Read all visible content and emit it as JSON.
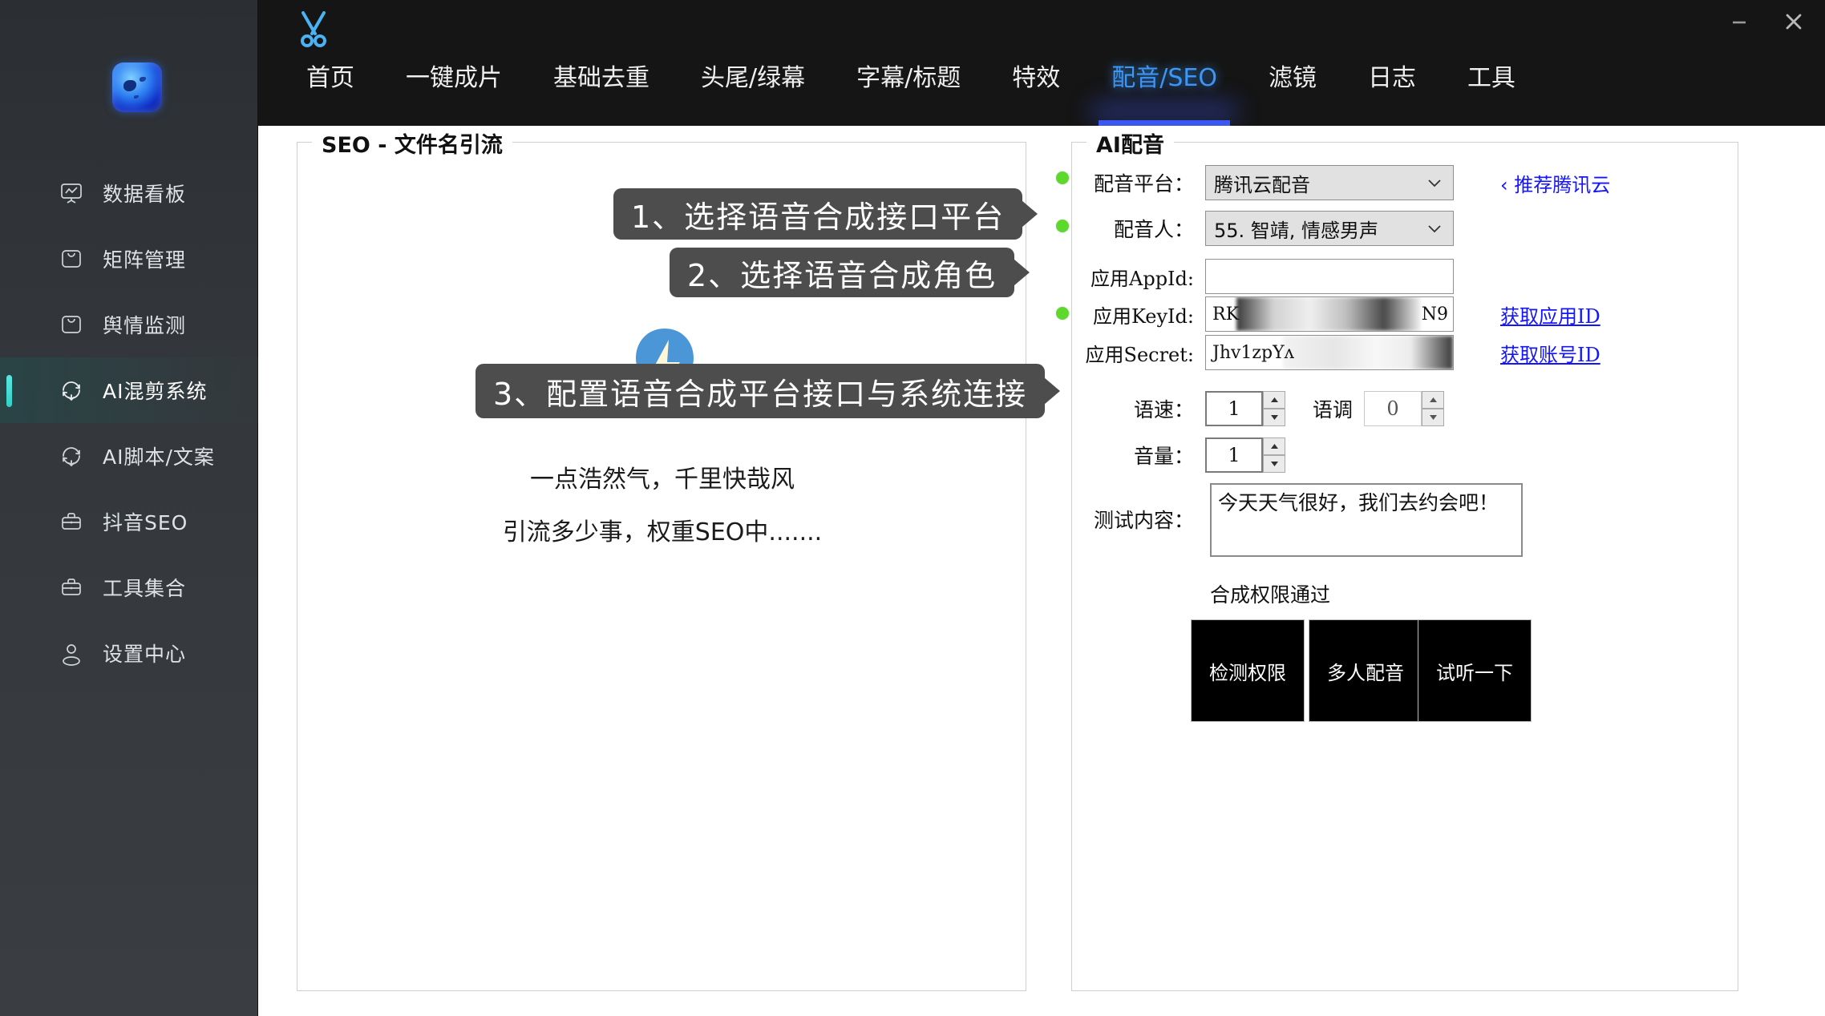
{
  "window": {
    "minimize_label": "–",
    "close_label": "✕"
  },
  "sidebar": {
    "logo_name": "app-logo",
    "items": [
      {
        "label": "数据看板",
        "icon": "dashboard-icon",
        "active": false
      },
      {
        "label": "矩阵管理",
        "icon": "matrix-icon",
        "active": false
      },
      {
        "label": "舆情监测",
        "icon": "monitor-icon",
        "active": false
      },
      {
        "label": "AI混剪系统",
        "icon": "refresh-icon",
        "active": true
      },
      {
        "label": "AI脚本/文案",
        "icon": "refresh-icon",
        "active": false
      },
      {
        "label": "抖音SEO",
        "icon": "briefcase-icon",
        "active": false
      },
      {
        "label": "工具集合",
        "icon": "briefcase-icon",
        "active": false
      },
      {
        "label": "设置中心",
        "icon": "user-icon",
        "active": false
      }
    ]
  },
  "topbar": {
    "logo_icon": "scissors-icon",
    "tabs": [
      {
        "label": "首页",
        "active": false
      },
      {
        "label": "一键成片",
        "active": false
      },
      {
        "label": "基础去重",
        "active": false
      },
      {
        "label": "头尾/绿幕",
        "active": false
      },
      {
        "label": "字幕/标题",
        "active": false
      },
      {
        "label": "特效",
        "active": false
      },
      {
        "label": "配音/SEO",
        "active": true
      },
      {
        "label": "滤镜",
        "active": false
      },
      {
        "label": "日志",
        "active": false
      },
      {
        "label": "工具",
        "active": false
      }
    ]
  },
  "seo_panel": {
    "title": "SEO - 文件名引流",
    "bulb_icon": "lightbulb-icon",
    "line1": "一点浩然气，千里快哉风",
    "line2": "引流多少事，权重SEO中......."
  },
  "ai_panel": {
    "title": "AI配音",
    "platform": {
      "label": "配音平台：",
      "value": "腾讯云配音",
      "hint": "‹ 推荐腾讯云"
    },
    "speaker": {
      "label": "配音人：",
      "value": "55. 智靖, 情感男声"
    },
    "appid": {
      "label": "应用AppId:",
      "value": "",
      "placeholder": ""
    },
    "keyid": {
      "label": "应用KeyId:",
      "value_prefix": "RK",
      "value_suffix": "N9",
      "link": "获取应用ID"
    },
    "secret": {
      "label": "应用Secret:",
      "value_prefix": "Jhv1zpYʌ",
      "link": "获取账号ID"
    },
    "speed": {
      "label": "语速：",
      "value": "1"
    },
    "pitch": {
      "label": "语调",
      "value": "0"
    },
    "volume": {
      "label": "音量：",
      "value": "1"
    },
    "test": {
      "label": "测试内容：",
      "value": "今天天气很好，我们去约会吧！"
    },
    "status": "合成权限通过",
    "buttons": [
      {
        "label": "检测权限"
      },
      {
        "label": "多人配音"
      },
      {
        "label": "试听一下"
      }
    ]
  },
  "callouts": [
    {
      "text": "1、选择语音合成接口平台"
    },
    {
      "text": "2、选择语音合成角色"
    },
    {
      "text": "3、配置语音合成平台接口与系统连接"
    }
  ],
  "colors": {
    "accent_blue": "#3d97f7",
    "tab_underline": "#3b57f0",
    "sidebar_active": "#2fd0c8",
    "green_dot": "#5dd92e",
    "link_blue": "#1414ff",
    "callout_bg": "#4d4d4d"
  }
}
